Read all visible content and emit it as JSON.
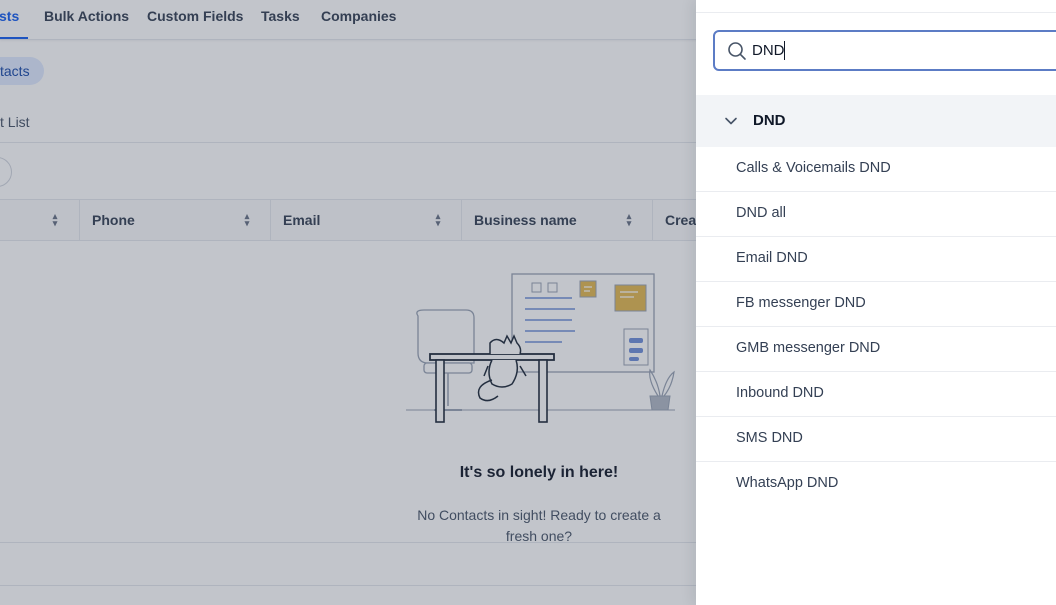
{
  "nav": {
    "tabs": [
      {
        "label": "sts"
      },
      {
        "label": "Bulk Actions"
      },
      {
        "label": "Custom Fields"
      },
      {
        "label": "Tasks"
      },
      {
        "label": "Companies"
      }
    ]
  },
  "filters": {
    "chip_label": "tacts",
    "list_label": "t List"
  },
  "table": {
    "columns": [
      {
        "label": ""
      },
      {
        "label": "Phone"
      },
      {
        "label": "Email"
      },
      {
        "label": "Business name"
      },
      {
        "label": "Creat"
      }
    ]
  },
  "empty_state": {
    "title": "It's so lonely in here!",
    "subtitle": "No Contacts in sight! Ready to create a fresh one?"
  },
  "panel": {
    "search": {
      "value": "DND"
    },
    "group": {
      "label": "DND",
      "items": [
        {
          "label": "Calls & Voicemails DND"
        },
        {
          "label": "DND all"
        },
        {
          "label": "Email DND"
        },
        {
          "label": "FB messenger DND"
        },
        {
          "label": "GMB messenger DND"
        },
        {
          "label": "Inbound DND"
        },
        {
          "label": "SMS DND"
        },
        {
          "label": "WhatsApp DND"
        }
      ]
    }
  },
  "colors": {
    "accent": "#155eef",
    "search_border": "#5c7cc5",
    "overlay": "#344054"
  }
}
